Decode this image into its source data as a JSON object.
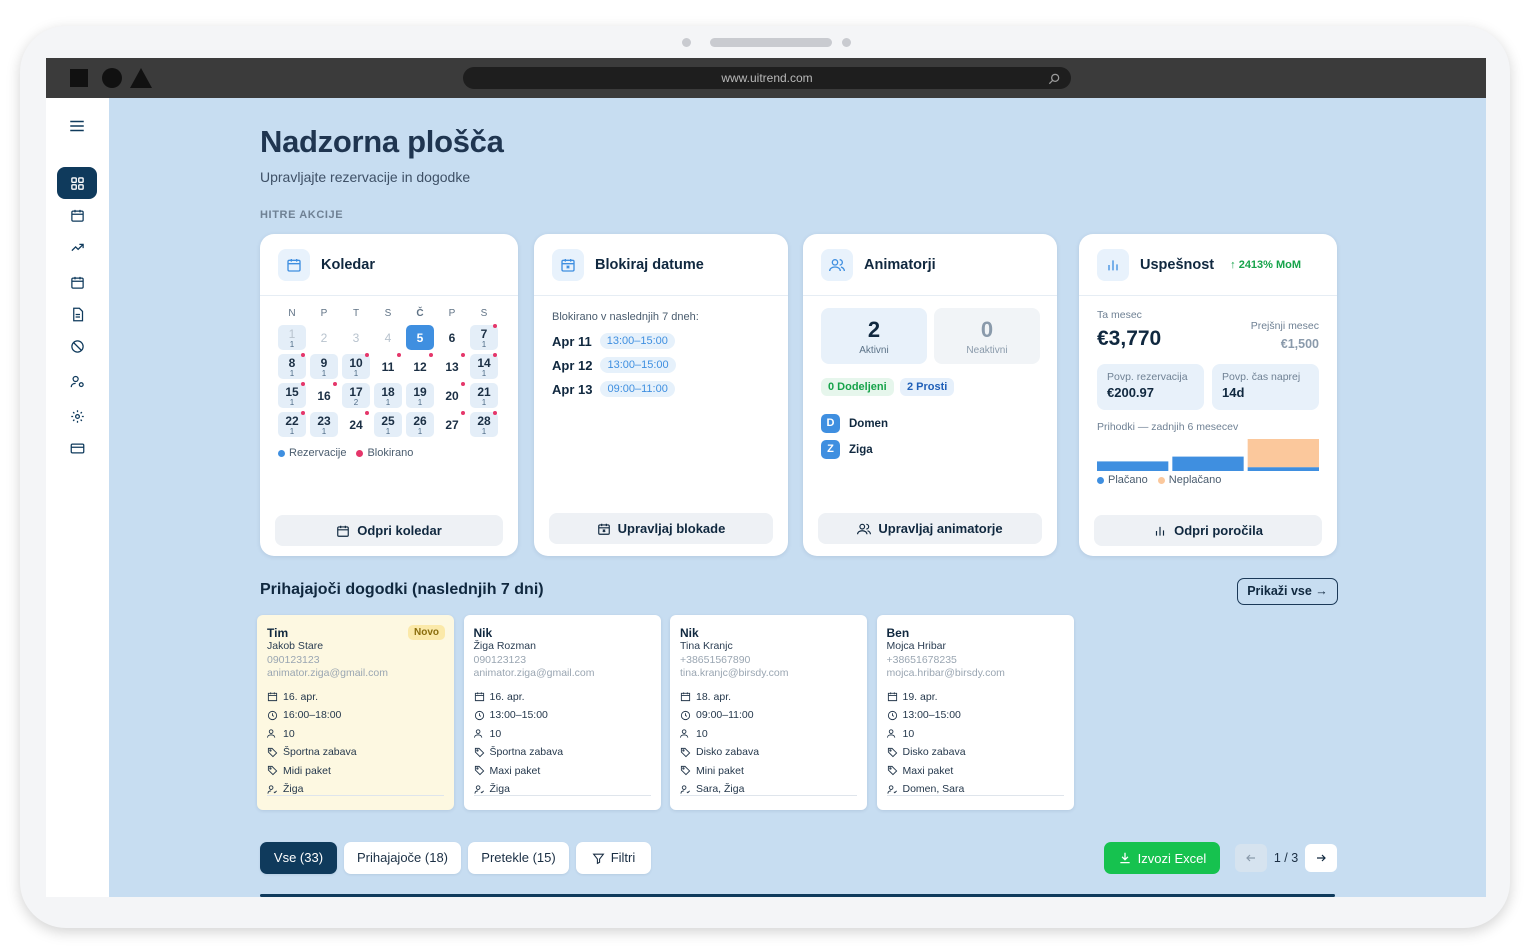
{
  "browser": {
    "url": "www.uitrend.com"
  },
  "page": {
    "title": "Nadzorna plošča",
    "subtitle": "Upravljajte rezervacije in dogodke",
    "quick_actions_label": "HITRE AKCIJE"
  },
  "calendar_card": {
    "title": "Koledar",
    "weekdays": [
      "N",
      "P",
      "T",
      "S",
      "Č",
      "P",
      "S"
    ],
    "legend_reservations": "Rezervacije",
    "legend_blocked": "Blokirano",
    "button": "Odpri koledar"
  },
  "calendar_days": [
    {
      "d": "1",
      "c": "1",
      "faded": true
    },
    {
      "d": "2",
      "faded": true
    },
    {
      "d": "3",
      "faded": true
    },
    {
      "d": "4",
      "faded": true
    },
    {
      "d": "5",
      "today": true
    },
    {
      "d": "6"
    },
    {
      "d": "7",
      "c": "1",
      "blk": true
    },
    {
      "d": "8",
      "c": "1",
      "blk": true
    },
    {
      "d": "9",
      "c": "1"
    },
    {
      "d": "10",
      "c": "1",
      "blk": true
    },
    {
      "d": "11",
      "blk": true
    },
    {
      "d": "12",
      "blk": true
    },
    {
      "d": "13",
      "blk": true
    },
    {
      "d": "14",
      "c": "1",
      "blk": true
    },
    {
      "d": "15",
      "c": "1",
      "blk": true
    },
    {
      "d": "16",
      "blk": true
    },
    {
      "d": "17",
      "c": "2"
    },
    {
      "d": "18",
      "c": "1"
    },
    {
      "d": "19",
      "c": "1"
    },
    {
      "d": "20",
      "blk": true
    },
    {
      "d": "21",
      "c": "1"
    },
    {
      "d": "22",
      "c": "1",
      "blk": true
    },
    {
      "d": "23",
      "c": "1"
    },
    {
      "d": "24",
      "blk": true
    },
    {
      "d": "25",
      "c": "1"
    },
    {
      "d": "26",
      "c": "1"
    },
    {
      "d": "27",
      "blk": true
    },
    {
      "d": "28",
      "c": "1",
      "blk": true
    }
  ],
  "block_card": {
    "title": "Blokiraj datume",
    "caption": "Blokirano v naslednjih 7 dneh:",
    "rows": [
      {
        "date": "Apr 11",
        "time": "13:00–15:00"
      },
      {
        "date": "Apr 12",
        "time": "13:00–15:00"
      },
      {
        "date": "Apr 13",
        "time": "09:00–11:00"
      }
    ],
    "button": "Upravljaj blokade"
  },
  "animators_card": {
    "title": "Animatorji",
    "active_num": "2",
    "active_label": "Aktivni",
    "inactive_num": "0",
    "inactive_label": "Neaktivni",
    "assigned": "0 Dodeljeni",
    "free": "2 Prosti",
    "list": [
      {
        "initial": "D",
        "name": "Domen"
      },
      {
        "initial": "Z",
        "name": "Ziga"
      }
    ],
    "button": "Upravljaj animatorje"
  },
  "success_card": {
    "title": "Uspešnost",
    "mom": "↑ 2413% MoM",
    "this_month_label": "Ta mesec",
    "this_month_value": "€3,770",
    "prev_month_label": "Prejšnji mesec",
    "prev_month_value": "€1,500",
    "avg_res_label": "Povp. rezervacija",
    "avg_res_value": "€200.97",
    "avg_time_label": "Povp. čas naprej",
    "avg_time_value": "14d",
    "chart_label": "Prihodki — zadnjih 6 mesecev",
    "legend_paid": "Plačano",
    "legend_unpaid": "Neplačano",
    "button": "Odpri poročila",
    "colors": {
      "paid": "#3f8fe0",
      "unpaid": "#fbc89c"
    }
  },
  "chart_data": {
    "type": "bar",
    "stacked": true,
    "series": [
      {
        "name": "Plačano",
        "values": [
          0.3,
          0.45,
          0.12
        ]
      },
      {
        "name": "Neplačano",
        "values": [
          0,
          0,
          0.88
        ]
      }
    ],
    "scale": "relative (no axis printed)"
  },
  "events": {
    "title": "Prihajajoči dogodki (naslednjih 7 dni)",
    "show_all": "Prikaži vse →",
    "new_badge": "Novo",
    "items": [
      {
        "name": "Tim",
        "customer": "Jakob Stare",
        "phone": "090123123",
        "email": "animator.ziga@gmail.com",
        "date": "16. apr.",
        "time": "16:00–18:00",
        "kids": "10",
        "type": "Športna zabava",
        "package": "Midi paket",
        "animators": "Žiga"
      },
      {
        "name": "Nik",
        "customer": "Žiga Rozman",
        "phone": "090123123",
        "email": "animator.ziga@gmail.com",
        "date": "16. apr.",
        "time": "13:00–15:00",
        "kids": "10",
        "type": "Športna zabava",
        "package": "Maxi paket",
        "animators": "Žiga"
      },
      {
        "name": "Nik",
        "customer": "Tina Kranjc",
        "phone": "+38651567890",
        "email": "tina.kranjc@birsdy.com",
        "date": "18. apr.",
        "time": "09:00–11:00",
        "kids": "10",
        "type": "Disko zabava",
        "package": "Mini paket",
        "animators": "Sara, Žiga"
      },
      {
        "name": "Ben",
        "customer": "Mojca Hribar",
        "phone": "+38651678235",
        "email": "mojca.hribar@birsdy.com",
        "date": "19. apr.",
        "time": "13:00–15:00",
        "kids": "10",
        "type": "Disko zabava",
        "package": "Maxi paket",
        "animators": "Domen, Sara"
      }
    ]
  },
  "filters": {
    "all": "Vse (33)",
    "upcoming": "Prihajajoče (18)",
    "past": "Pretekle (15)",
    "filters": "Filtri",
    "export": "Izvozi Excel",
    "page": "1 / 3"
  },
  "colors": {
    "primary": "#0f3a5c",
    "accent": "#3f8fe0",
    "success": "#16c24f",
    "background": "#c7ddf1",
    "blocked": "#e5366a"
  }
}
